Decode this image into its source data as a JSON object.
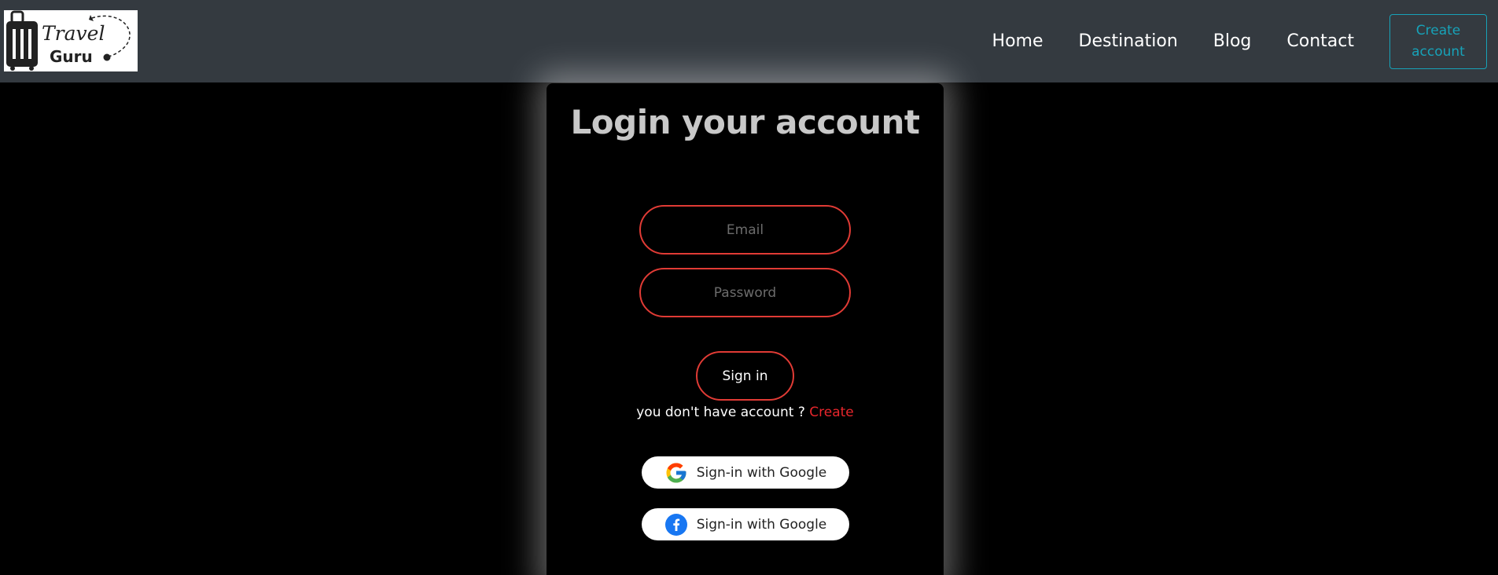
{
  "brand": {
    "logo_word1": "Travel",
    "logo_word2": "Guru"
  },
  "nav": {
    "items": [
      {
        "label": "Home"
      },
      {
        "label": "Destination"
      },
      {
        "label": "Blog"
      },
      {
        "label": "Contact"
      }
    ],
    "create_account_line1": "Create",
    "create_account_line2": "account"
  },
  "login": {
    "title": "Login your account",
    "email_placeholder": "Email",
    "password_placeholder": "Password",
    "signin_label": "Sign in",
    "no_account_text": "you don't have account ?",
    "create_link": "Create",
    "google_button_label": "Sign-in with Google",
    "facebook_button_label": "Sign-in with Google"
  },
  "colors": {
    "navbar_bg": "#343a40",
    "accent_red": "#e03b35",
    "create_link": "#e8262c",
    "create_button": "#17a2b8",
    "page_bg": "#000000"
  },
  "icons": [
    "suitcase-logo-icon",
    "google-icon",
    "facebook-icon"
  ]
}
